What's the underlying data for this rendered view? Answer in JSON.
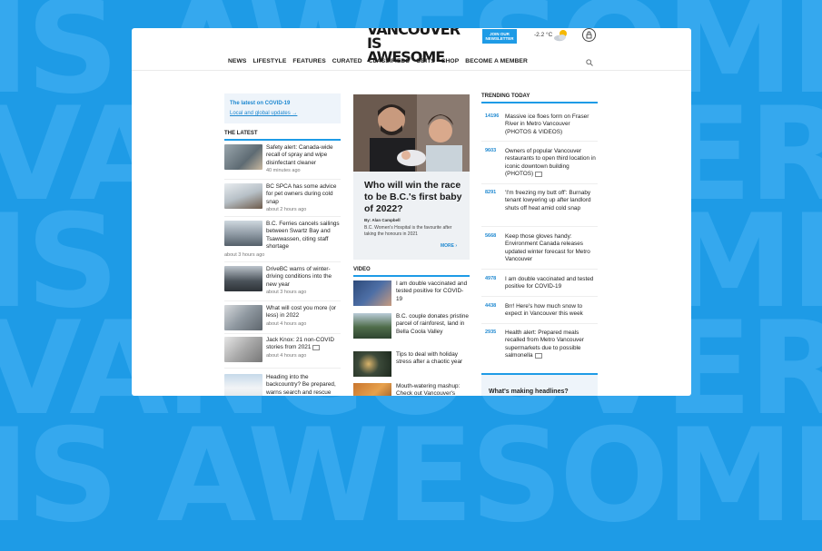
{
  "background_words": [
    "IS AWESOME",
    "VANCOUVER",
    "IS AWESOME",
    "VANCOUVER",
    "IS AWESOME"
  ],
  "logo": {
    "line1": "VANCOUVER",
    "line2": "IS AWESOME"
  },
  "header": {
    "newsletter_label": "JOIN OUR NEWSLETTER",
    "temperature": "-2.2 °C"
  },
  "nav": [
    "NEWS",
    "LIFESTYLE",
    "FEATURES",
    "CURATED",
    "CLASSIFIEDS",
    "OBITS",
    "SHOP",
    "BECOME A MEMBER"
  ],
  "covid_box": {
    "title": "The latest on COVID-19",
    "link": "Local and global updates →"
  },
  "latest": {
    "heading": "THE LATEST",
    "items": [
      {
        "text": "Safety alert: Canada-wide recall of spray and wipe disinfectant cleaner",
        "time": "40 minutes ago"
      },
      {
        "text": "BC SPCA has some advice for pet owners during cold snap",
        "time": "about 2 hours ago"
      },
      {
        "text": "B.C. Ferries cancels sailings between Swartz Bay and Tsawwassen, citing staff shortage",
        "time": "about 3 hours ago"
      },
      {
        "text": "DriveBC warns of winter-driving conditions into the new year",
        "time": "about 3 hours ago"
      },
      {
        "text": "What will cost you more (or less) in 2022",
        "time": "about 4 hours ago"
      },
      {
        "text": "Jack Knox: 21 non-COVID stories from 2021",
        "time": "about 4 hours ago"
      },
      {
        "text": "Heading into the backcountry? Be prepared, warns search and rescue",
        "time": ""
      }
    ]
  },
  "feature": {
    "title": "Who will win the race to be B.C.'s first baby of 2022?",
    "byline": "By: Alan Campbell",
    "description": "B.C. Women's Hospital is the favourite after taking the honours in 2021",
    "more": "MORE ›"
  },
  "video": {
    "heading": "VIDEO",
    "items": [
      {
        "text": "I am double vaccinated and tested positive for COVID-19"
      },
      {
        "text": "B.C. couple donates pristine parcel of rainforest, land in Bella Coola Valley"
      },
      {
        "text": "Tips to deal with holiday stress after a chaotic year"
      },
      {
        "text": "Mouth-watering mashup: Check out Vancouver's"
      }
    ]
  },
  "trending": {
    "heading": "TRENDING TODAY",
    "items": [
      {
        "count": "14196",
        "text": "Massive ice floes form on Fraser River in Metro Vancouver (PHOTOS & VIDEOS)"
      },
      {
        "count": "9603",
        "text": "Owners of popular Vancouver restaurants to open third location in iconic downtown building (PHOTOS)"
      },
      {
        "count": "8291",
        "text": "'I'm freezing my butt off': Burnaby tenant lowyering up after landlord shuts off heat amid cold snap"
      },
      {
        "count": "5668",
        "text": "Keep those gloves handy: Environment Canada releases updated winter forecast for Metro Vancouver"
      },
      {
        "count": "4978",
        "text": "I am double vaccinated and tested positive for COVID-19"
      },
      {
        "count": "4438",
        "text": "Brr! Here's how much snow to expect in Vancouver this week"
      },
      {
        "count": "2935",
        "text": "Health alert: Prepared meals recalled from Metro Vancouver supermarkets due to possible salmonella"
      }
    ]
  },
  "headlines_box": {
    "title": "What's making headlines?"
  },
  "colors": {
    "brand_blue": "#1e9be6",
    "link_blue": "#1e88d0"
  }
}
